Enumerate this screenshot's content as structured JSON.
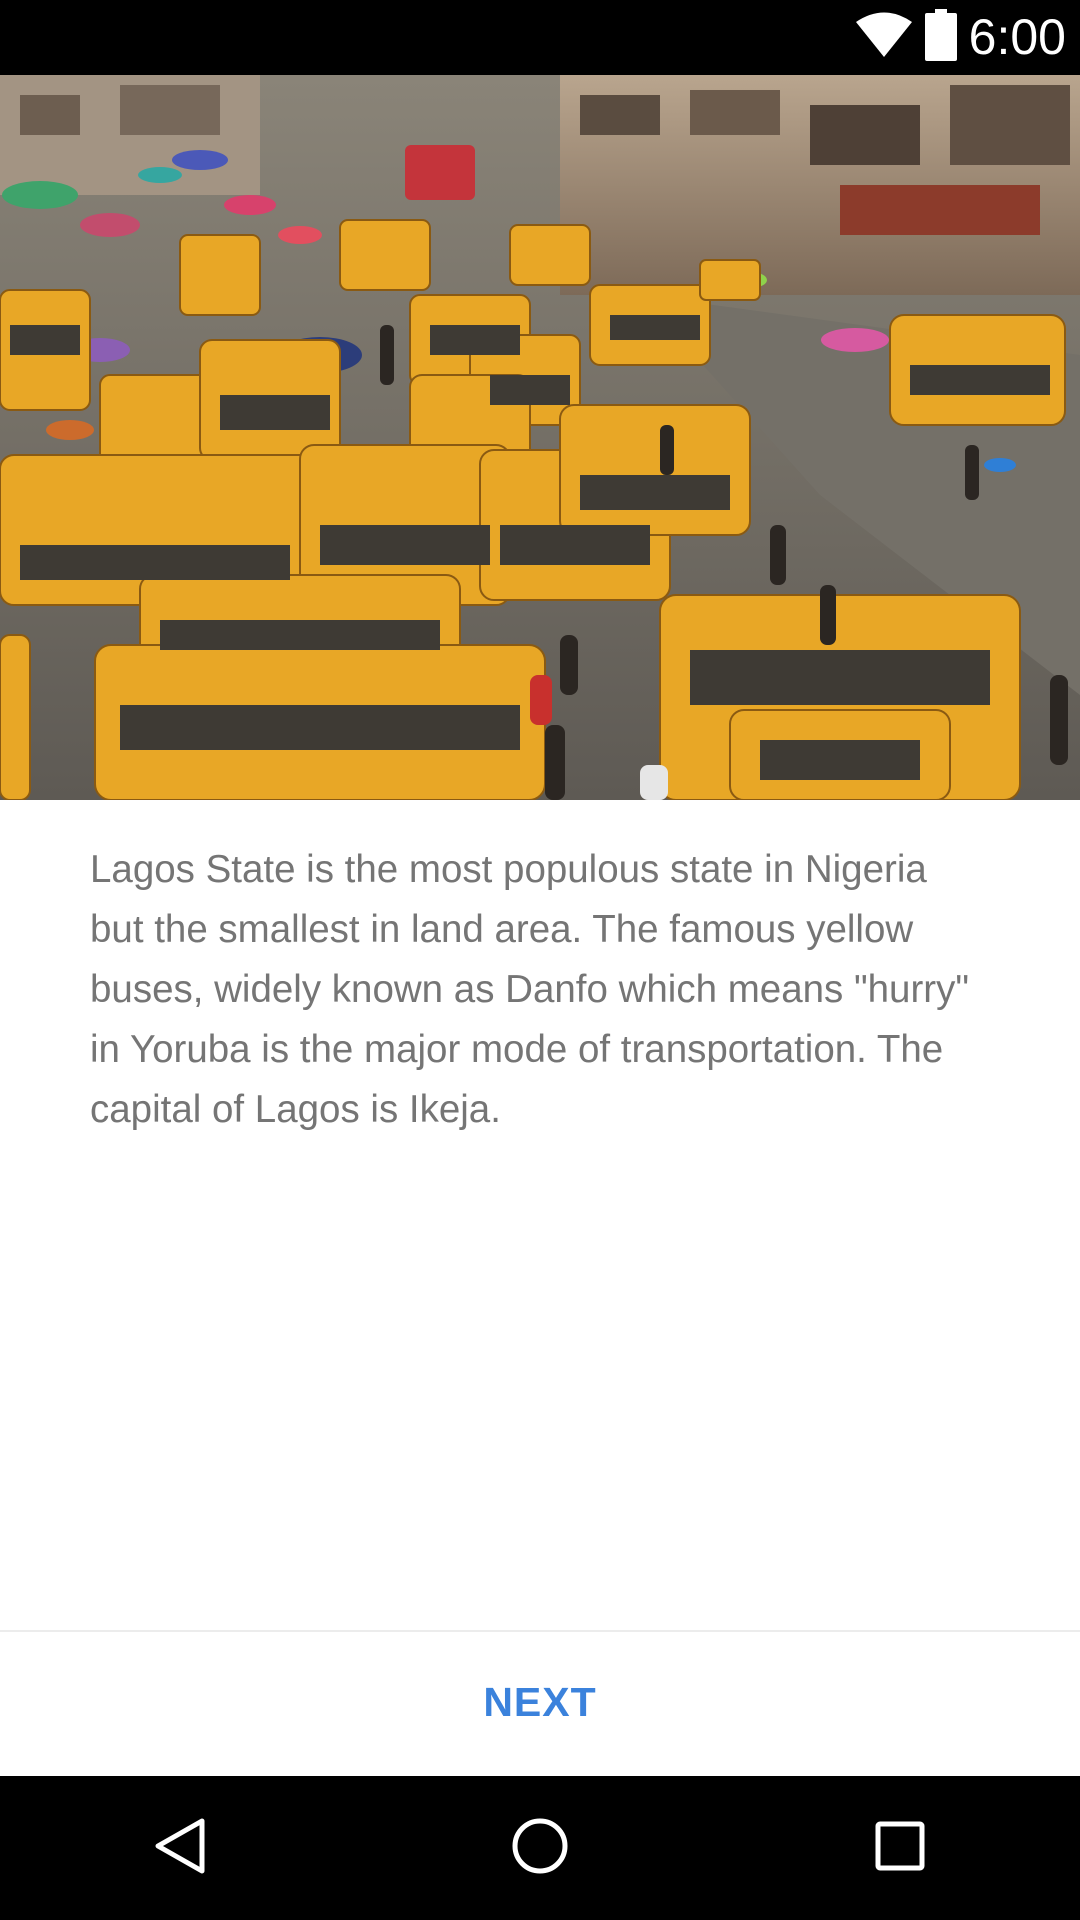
{
  "status_bar": {
    "time": "6:00",
    "icons": [
      "wifi-icon",
      "battery-icon"
    ]
  },
  "photo": {
    "subject": "yellow-danfo-buses-traffic"
  },
  "content": {
    "description": "Lagos State is the most populous state in Nigeria but the smallest in land area. The famous yellow buses, widely known as Danfo which means \"hurry\" in Yoruba is the major mode of transportation. The capital of Lagos is Ikeja."
  },
  "actions": {
    "next_label": "NEXT"
  },
  "nav_bar": {
    "icons": [
      "back-icon",
      "home-icon",
      "recents-icon"
    ]
  },
  "colors": {
    "accent": "#3b82dc",
    "text": "#757575",
    "bus_yellow": "#e8a726"
  }
}
